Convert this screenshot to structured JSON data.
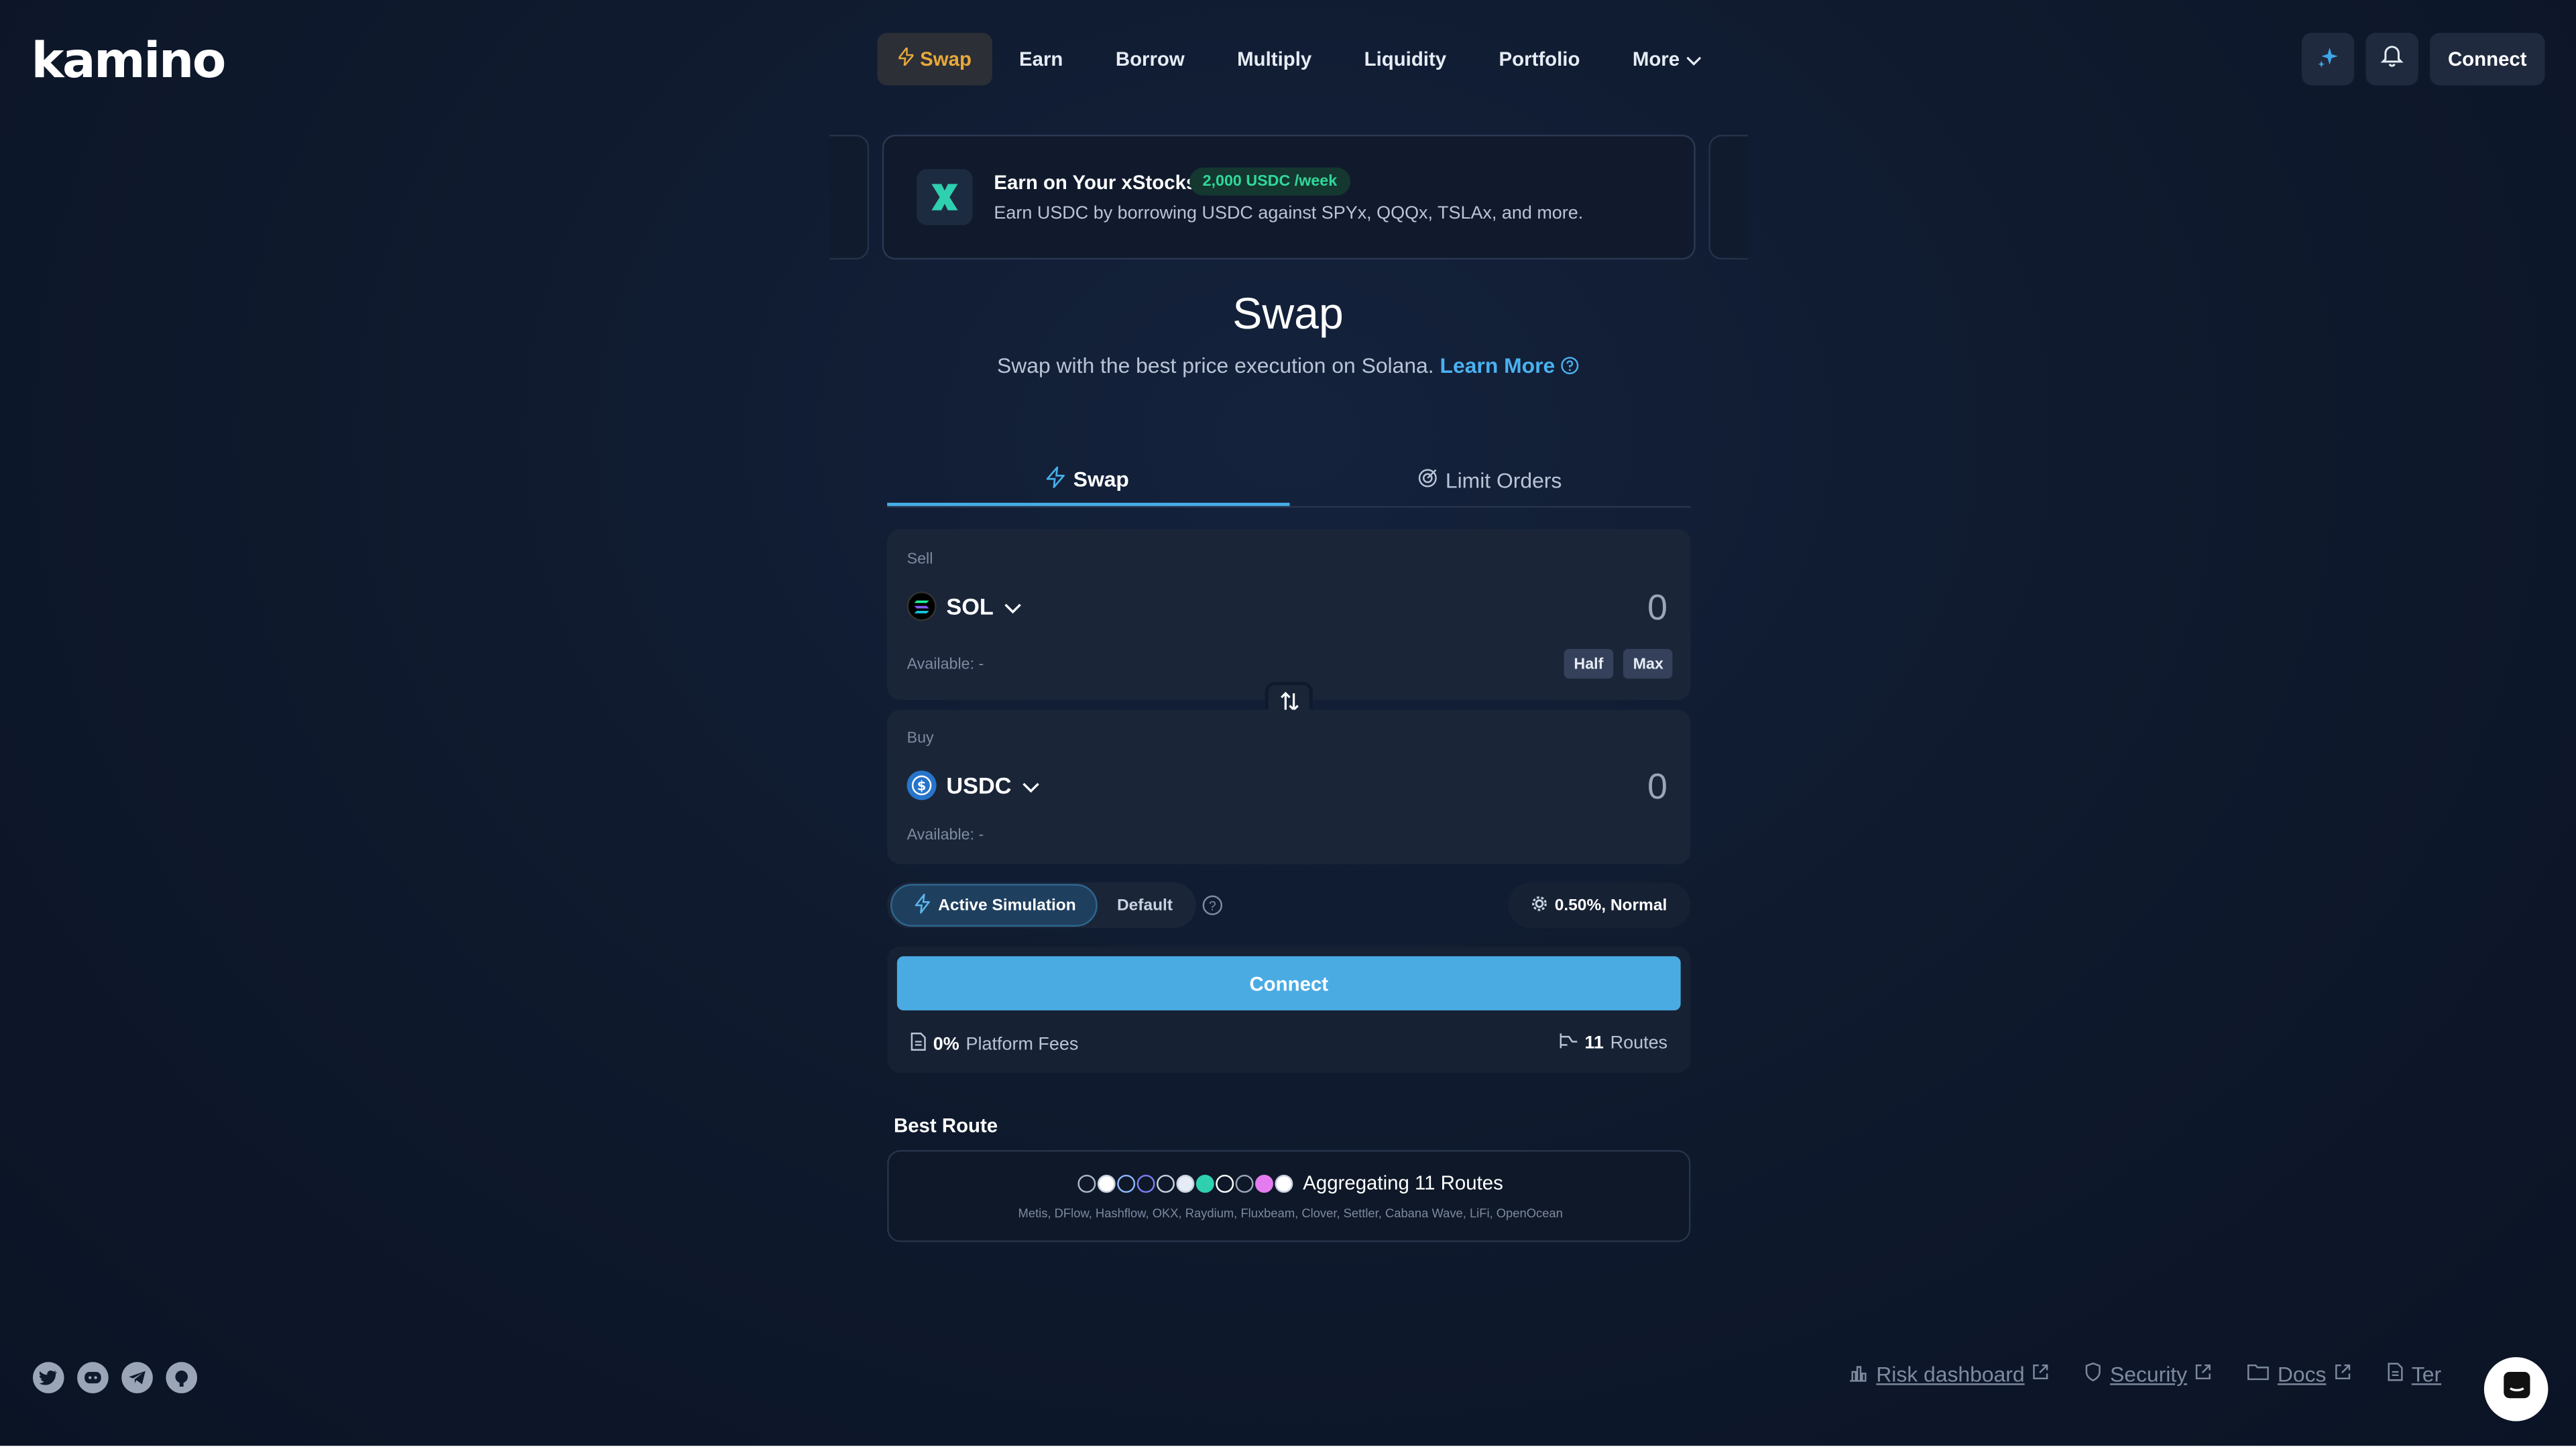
{
  "app": {
    "logo_text": "kamino"
  },
  "nav": {
    "items": [
      {
        "label": "Swap",
        "active": true
      },
      {
        "label": "Earn"
      },
      {
        "label": "Borrow"
      },
      {
        "label": "Multiply"
      },
      {
        "label": "Liquidity"
      },
      {
        "label": "Portfolio"
      },
      {
        "label": "More"
      }
    ]
  },
  "header": {
    "connect_label": "Connect",
    "icons": [
      "sparkle-icon",
      "bell-icon"
    ]
  },
  "banner": {
    "title": "Earn on Your xStocks",
    "badge": "2,000 USDC /week",
    "description": "Earn USDC by borrowing USDC against SPYx, QQQx, TSLAx, and more."
  },
  "page": {
    "title": "Swap",
    "subtitle": "Swap with the best price execution on Solana.",
    "learn_more": "Learn More"
  },
  "tabs": [
    {
      "label": "Swap",
      "active": true,
      "icon": "bolt-icon"
    },
    {
      "label": "Limit Orders",
      "icon": "target-icon"
    }
  ],
  "sell": {
    "label": "Sell",
    "token": "SOL",
    "amount": "0",
    "available": "Available: -",
    "half_label": "Half",
    "max_label": "Max"
  },
  "buy": {
    "label": "Buy",
    "token": "USDC",
    "amount": "0",
    "available": "Available: -"
  },
  "simulation": {
    "active_label": "Active Simulation",
    "default_label": "Default",
    "slippage": "0.50%, Normal"
  },
  "connect": {
    "button_label": "Connect",
    "fees_value": "0%",
    "fees_label": "Platform Fees",
    "routes_value": "11",
    "routes_label": "Routes"
  },
  "best_route": {
    "title": "Best Route",
    "summary": "Aggregating 11 Routes",
    "providers": "Metis, DFlow, Hashflow, OKX, Raydium, Fluxbeam, Clover, Settler, Cabana Wave, LiFi, OpenOcean"
  },
  "footer": {
    "social": [
      "twitter-icon",
      "discord-icon",
      "telegram-icon",
      "github-icon"
    ],
    "links": [
      {
        "label": "Risk dashboard"
      },
      {
        "label": "Security"
      },
      {
        "label": "Docs"
      },
      {
        "label": "Ter"
      }
    ]
  },
  "colors": {
    "accent": "#4aabe3",
    "active_nav": "#e9a93a",
    "badge_green": "#2fd89a",
    "background": "#0f1a2e"
  }
}
